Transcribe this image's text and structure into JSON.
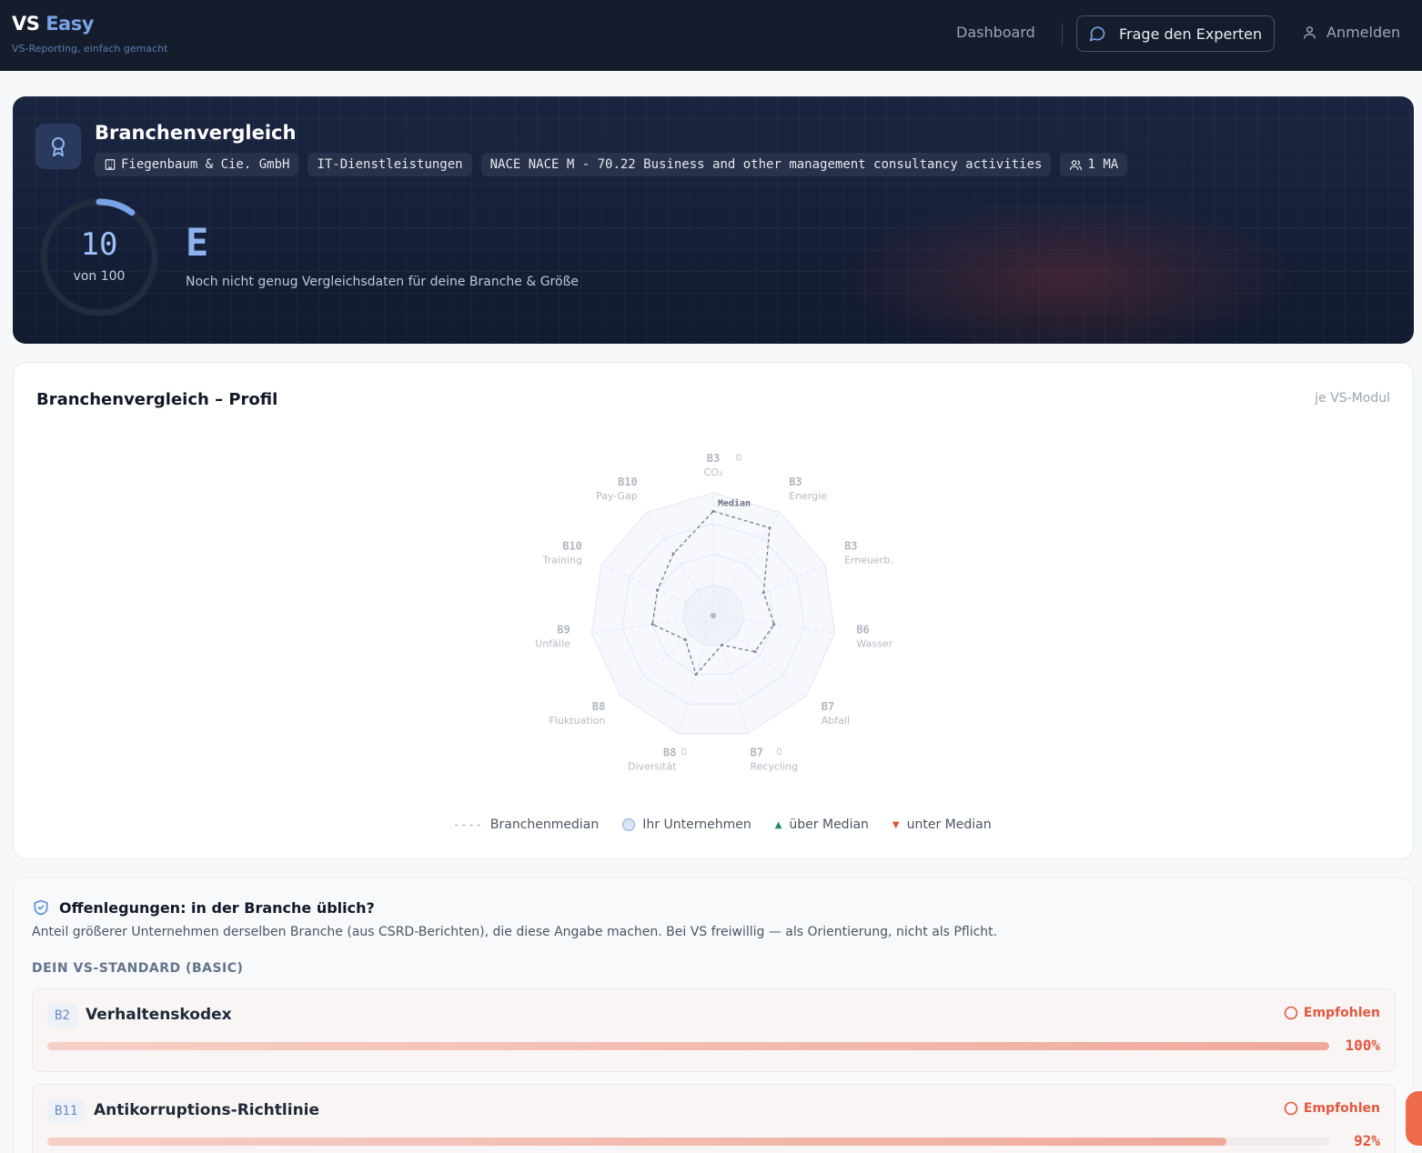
{
  "header": {
    "brand_main": "VS",
    "brand_accent": "Easy",
    "tagline": "VS-Reporting, einfach gemacht",
    "nav_dashboard": "Dashboard",
    "nav_expert": "Frage den Experten",
    "nav_login": "Anmelden",
    "icons": {
      "expert": "chat-bubble-icon",
      "login": "user-icon"
    }
  },
  "hero": {
    "icon": "award-ribbon-icon",
    "title": "Branchenvergleich",
    "chips": {
      "company": "Fiegenbaum & Cie. GmbH",
      "industry": "IT-Dienstleistungen",
      "nace": "NACE NACE M - 70.22 Business and other management consultancy activities",
      "employees": "1 MA"
    },
    "score": {
      "value": "10",
      "max_label": "von 100",
      "fraction": 0.1
    },
    "grade": "E",
    "note": "Noch nicht genug Vergleichsdaten für deine Branche & Größe",
    "colors": {
      "accent": "#7aa2e6",
      "ring_track": "#232c3e"
    }
  },
  "profile": {
    "title": "Branchenvergleich – Profil",
    "subtitle": "je VS-Modul",
    "median_label": "Median",
    "axes": [
      {
        "code": "B3",
        "label": "CO₂",
        "median": 0.85,
        "info": true
      },
      {
        "code": "B3",
        "label": "Energie",
        "median": 0.85,
        "info": false
      },
      {
        "code": "B3",
        "label": "Erneuerb.",
        "median": 0.45,
        "info": false
      },
      {
        "code": "B6",
        "label": "Wasser",
        "median": 0.5,
        "info": false
      },
      {
        "code": "B7",
        "label": "Abfall",
        "median": 0.45,
        "info": false
      },
      {
        "code": "B7",
        "label": "Recycling",
        "median": 0.25,
        "info": true
      },
      {
        "code": "B8",
        "label": "Diversität",
        "median": 0.5,
        "info": true
      },
      {
        "code": "B8",
        "label": "Fluktuation",
        "median": 0.3,
        "info": false
      },
      {
        "code": "B9",
        "label": "Unfälle",
        "median": 0.5,
        "info": false
      },
      {
        "code": "B10",
        "label": "Training",
        "median": 0.5,
        "info": false
      },
      {
        "code": "B10",
        "label": "Pay-Gap",
        "median": 0.6,
        "info": false
      }
    ],
    "legend": {
      "median": "Branchenmedian",
      "company": "Ihr Unternehmen",
      "above": "über Median",
      "below": "unter Median",
      "dash_glyph": "----"
    }
  },
  "disclosures": {
    "title": "Offenlegungen: in der Branche üblich?",
    "icon": "shield-check-icon",
    "description": "Anteil größerer Unternehmen derselben Branche (aus CSRD-Berichten), die diese Angabe machen. Bei VS freiwillig — als Orientierung, nicht als Pflicht.",
    "section": "DEIN VS-STANDARD (BASIC)",
    "items": [
      {
        "code": "B2",
        "name": "Verhaltenskodex",
        "badge": "Empfohlen",
        "percent_label": "100%",
        "share": 1.0
      },
      {
        "code": "B11",
        "name": "Antikorruptions-Richtlinie",
        "badge": "Empfohlen",
        "percent_label": "92%",
        "share": 0.92
      }
    ]
  }
}
